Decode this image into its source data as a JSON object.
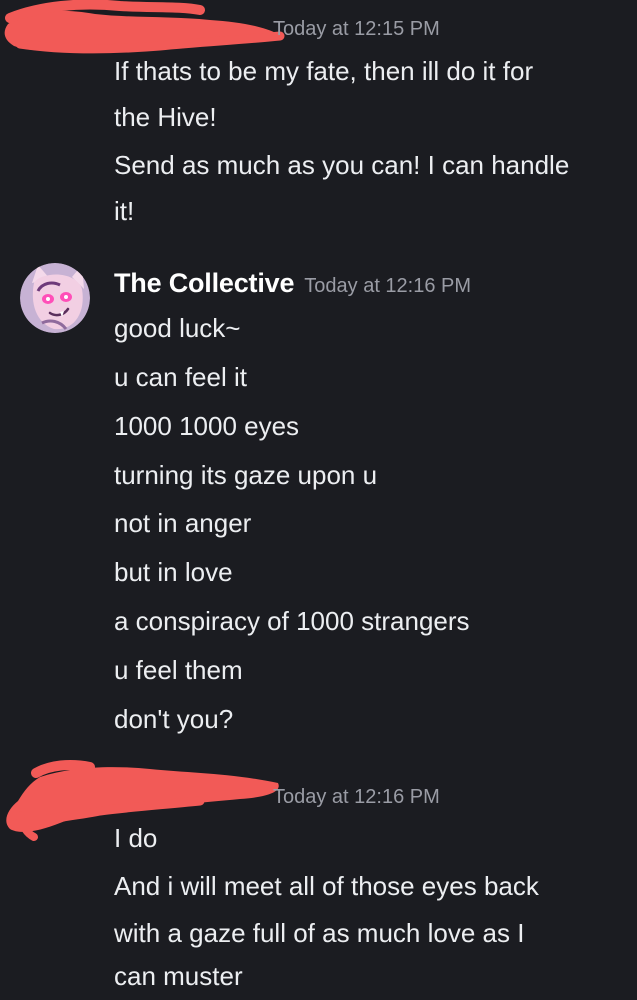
{
  "messages": [
    {
      "author": "",
      "timestamp": "Today at 12:15 PM",
      "lines": [
        "If thats to be my fate, then ill do it for",
        "the Hive!",
        "Send as much as you can! I can handle",
        "it!"
      ]
    },
    {
      "author": "The Collective",
      "timestamp": "Today at 12:16 PM",
      "lines": [
        "good luck~",
        "u can feel it",
        "1000 1000 eyes",
        "turning its gaze upon u",
        "not in anger",
        "but in love",
        "a conspiracy of 1000 strangers",
        "u feel them",
        "don't you?"
      ]
    },
    {
      "author": "",
      "timestamp": "Today at 12:16 PM",
      "lines": [
        "I do",
        "And i will meet all of those eyes back",
        "with a gaze full of as much love as I",
        "can muster"
      ]
    }
  ],
  "colors": {
    "background": "#1b1c21",
    "text": "#eceef1",
    "author": "#ffffff",
    "timestamp": "#9a9ca5",
    "redaction": "#f25a57"
  },
  "icons": {
    "avatar": "pink-creature-avatar-icon"
  }
}
